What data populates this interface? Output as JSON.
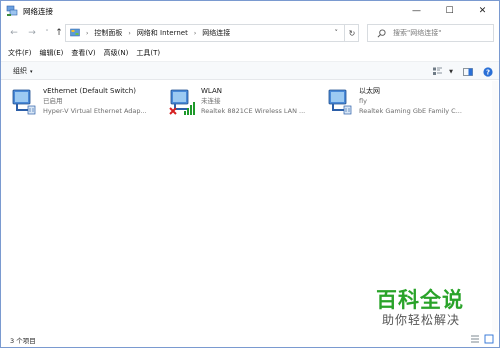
{
  "window": {
    "title": "网络连接",
    "icon": "network-connections-icon",
    "controls": {
      "minimize": "—",
      "maximize": "☐",
      "close": "✕"
    }
  },
  "nav": {
    "back": "←",
    "forward": "→",
    "recent": "˅",
    "up": "↑",
    "refresh": "↻",
    "breadcrumbs": [
      "控制面板",
      "网络和 Internet",
      "网络连接"
    ],
    "search_placeholder": "搜索\"网络连接\""
  },
  "menu": [
    "文件(F)",
    "编辑(E)",
    "查看(V)",
    "高级(N)",
    "工具(T)"
  ],
  "toolbar": {
    "organize": "组织",
    "organize_arrow": "▾"
  },
  "adapters": [
    {
      "name": "vEthernet (Default Switch)",
      "status": "已启用",
      "device": "Hyper-V Virtual Ethernet Adap...",
      "icon": "ethernet-adapter-icon",
      "overlay": ""
    },
    {
      "name": "WLAN",
      "status": "未连接",
      "device": "Realtek 8821CE Wireless LAN ...",
      "icon": "wireless-adapter-icon",
      "overlay": "disconnected-x"
    },
    {
      "name": "以太网",
      "status": "fly",
      "device": "Realtek Gaming GbE Family C...",
      "icon": "ethernet-adapter-icon",
      "overlay": ""
    }
  ],
  "status_bar": {
    "item_count": "3 个项目"
  },
  "watermark": {
    "title": "百科全说",
    "subtitle": "助你轻松解决"
  },
  "colors": {
    "accent": "#2a6fd6",
    "watermark_green": "#2aa32a",
    "error_red": "#d62020",
    "signal_green": "#1e9a2a"
  }
}
